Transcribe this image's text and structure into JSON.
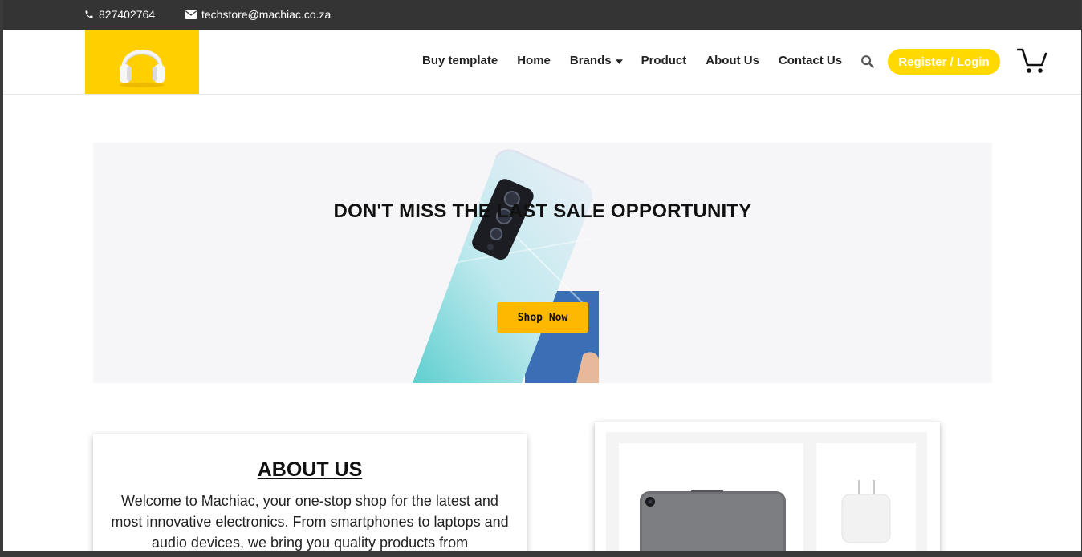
{
  "topbar": {
    "phone": "827402764",
    "email": "techstore@machiac.co.za"
  },
  "nav": {
    "items": [
      "Buy template",
      "Home",
      "Brands",
      "Product",
      "About Us",
      "Contact Us"
    ],
    "register_label": "Register / Login"
  },
  "banner": {
    "headline": "DON'T MISS THE LAST SALE OPPORTUNITY",
    "cta_label": "Shop Now"
  },
  "about": {
    "title": "ABOUT US",
    "text": "Welcome to Machiac, your one-stop shop for the latest and most innovative electronics. From smartphones to laptops and audio devices, we bring you quality products from"
  },
  "icons": {
    "phone": "phone-icon",
    "email": "envelope-icon",
    "brands_dropdown": "caret-down-icon",
    "search": "search-icon",
    "cart": "cart-icon",
    "logo": "headphones-logo"
  },
  "colors": {
    "topbar": "#343434",
    "accent_yellow": "#ffd900",
    "logo_yellow": "#ffcf00",
    "cta_orange": "#ffb800"
  }
}
